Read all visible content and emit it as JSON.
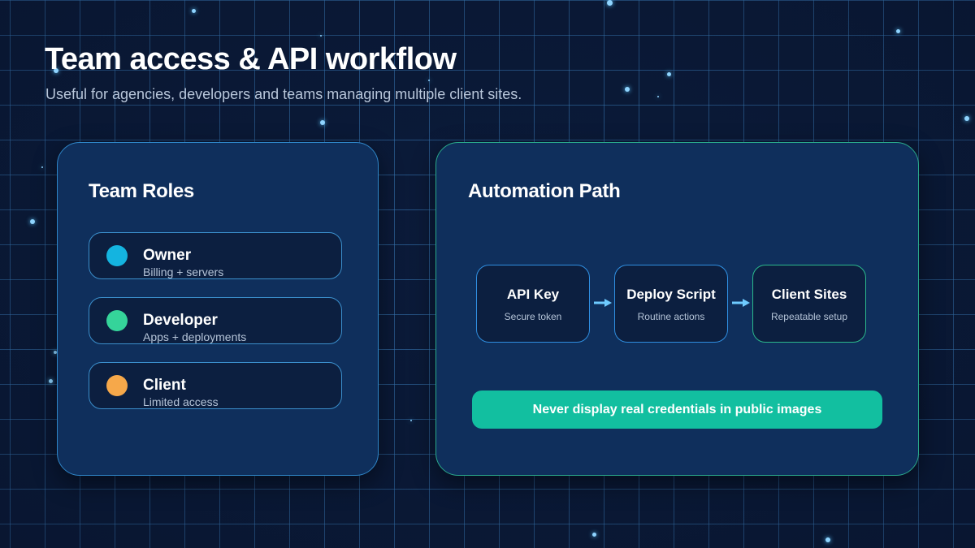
{
  "header": {
    "title": "Team access & API workflow",
    "subtitle": "Useful for agencies, developers and teams managing multiple client sites."
  },
  "roles_panel": {
    "title": "Team Roles",
    "roles": [
      {
        "name": "Owner",
        "description": "Billing + servers",
        "color": "#14b4e0"
      },
      {
        "name": "Developer",
        "description": "Apps + deployments",
        "color": "#35d49a"
      },
      {
        "name": "Client",
        "description": "Limited access",
        "color": "#f6a84a"
      }
    ]
  },
  "automation_panel": {
    "title": "Automation Path",
    "steps": [
      {
        "name": "API Key",
        "description": "Secure token",
        "border": "#2f8ee0"
      },
      {
        "name": "Deploy Script",
        "description": "Routine actions",
        "border": "#2f8ee0"
      },
      {
        "name": "Client Sites",
        "description": "Repeatable setup",
        "border": "#2bb88c"
      }
    ],
    "arrow_color": "#6ecbff",
    "notice": "Never display real credentials in public images",
    "notice_color": "#12bfa0"
  },
  "colors": {
    "background": "#0b1b3a",
    "grid": "#4696dc",
    "panel": "#0f2f5c"
  }
}
